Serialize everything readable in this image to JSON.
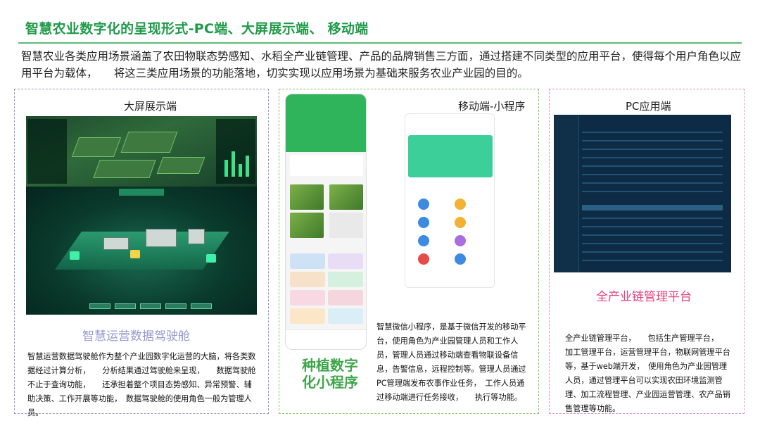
{
  "header": {
    "title": "智慧农业数字化的呈现形式-PC端、大屏展示端、 移动端",
    "intro": "智慧农业各类应用场景涵盖了农田物联态势感知、水稻全产业链管理、产品的品牌销售三方面，通过搭建不同类型的应用平台，使得每个用户角色以应用平台为载体，　　将这三类应用场景的功能落地，切实实现以应用场景为基础来服务农业产业园的目的。"
  },
  "panels": {
    "bigscreen": {
      "title": "大屏展示端",
      "name": "智慧运营数据驾驶舱",
      "desc": "智慧运营数据驾驶舱作为整个产业园数字化运营的大脑，将各类数据经过计算分析，　　分析结果通过驾驶舱来呈现，　　数据驾驶舱不止于查询功能，　　还承担着整个项目态势感知、异常预警、辅助决策、工作开展等功能，　数据驾驶舱的使用角色一般为管理人员。"
    },
    "mobile": {
      "title": "移动端-小程序",
      "name_line1": "种植数字",
      "name_line2": "化小程序",
      "desc": "智慧微信小程序，是基于微信开发的移动平台，使用角色为产业园管理人员和工作人员，管理人员通过移动端查看物联设备信息，告警信息，远程控制等。管理人员通过PC管理端发布农事作业任务，　工作人员通过移动端进行任务接收，　　执行等功能。"
    },
    "pc": {
      "title": "PC应用端",
      "name": "全产业链管理平台",
      "desc": "全产业链管理平台，　　包括生产管理平台，　　加工管理平台，运营管理平台，物联网管理平台等，基于web端开发，　使用角色为产业园管理人员，通过管理平台可以实现农田环境监测管理、加工流程管理、产业园运营管理、农产品销售管理等功能。"
    }
  },
  "colors": {
    "title_green": "#1e9a48",
    "rule_green": "#5bb978",
    "cockpit_purple": "#9c97cf",
    "mini_green": "#3ea64b",
    "platform_pink": "#e8417d"
  }
}
